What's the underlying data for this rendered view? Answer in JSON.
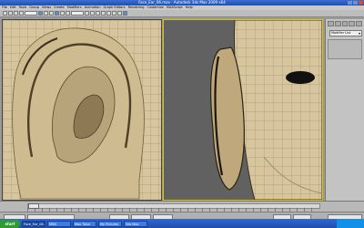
{
  "window": {
    "title": "Face_Ear_06.max - Autodesk 3ds Max 2009 x64"
  },
  "menus": [
    "File",
    "Edit",
    "Tools",
    "Group",
    "Views",
    "Create",
    "Modifiers",
    "Animation",
    "Graph Editors",
    "Rendering",
    "Customize",
    "MAXScript",
    "Help"
  ],
  "command_panel": {
    "modifier_dropdown": "Modifier List"
  },
  "taskbar": {
    "start_label": "start",
    "items": [
      "Face_Ear_06.max",
      "MSN",
      "Max Tutor",
      "My Pictures",
      "3ds Max"
    ]
  },
  "colors": {
    "skin": "#d7c59e",
    "active_viewport_border": "#d8c300",
    "right_viewport_bg": "#616161"
  }
}
